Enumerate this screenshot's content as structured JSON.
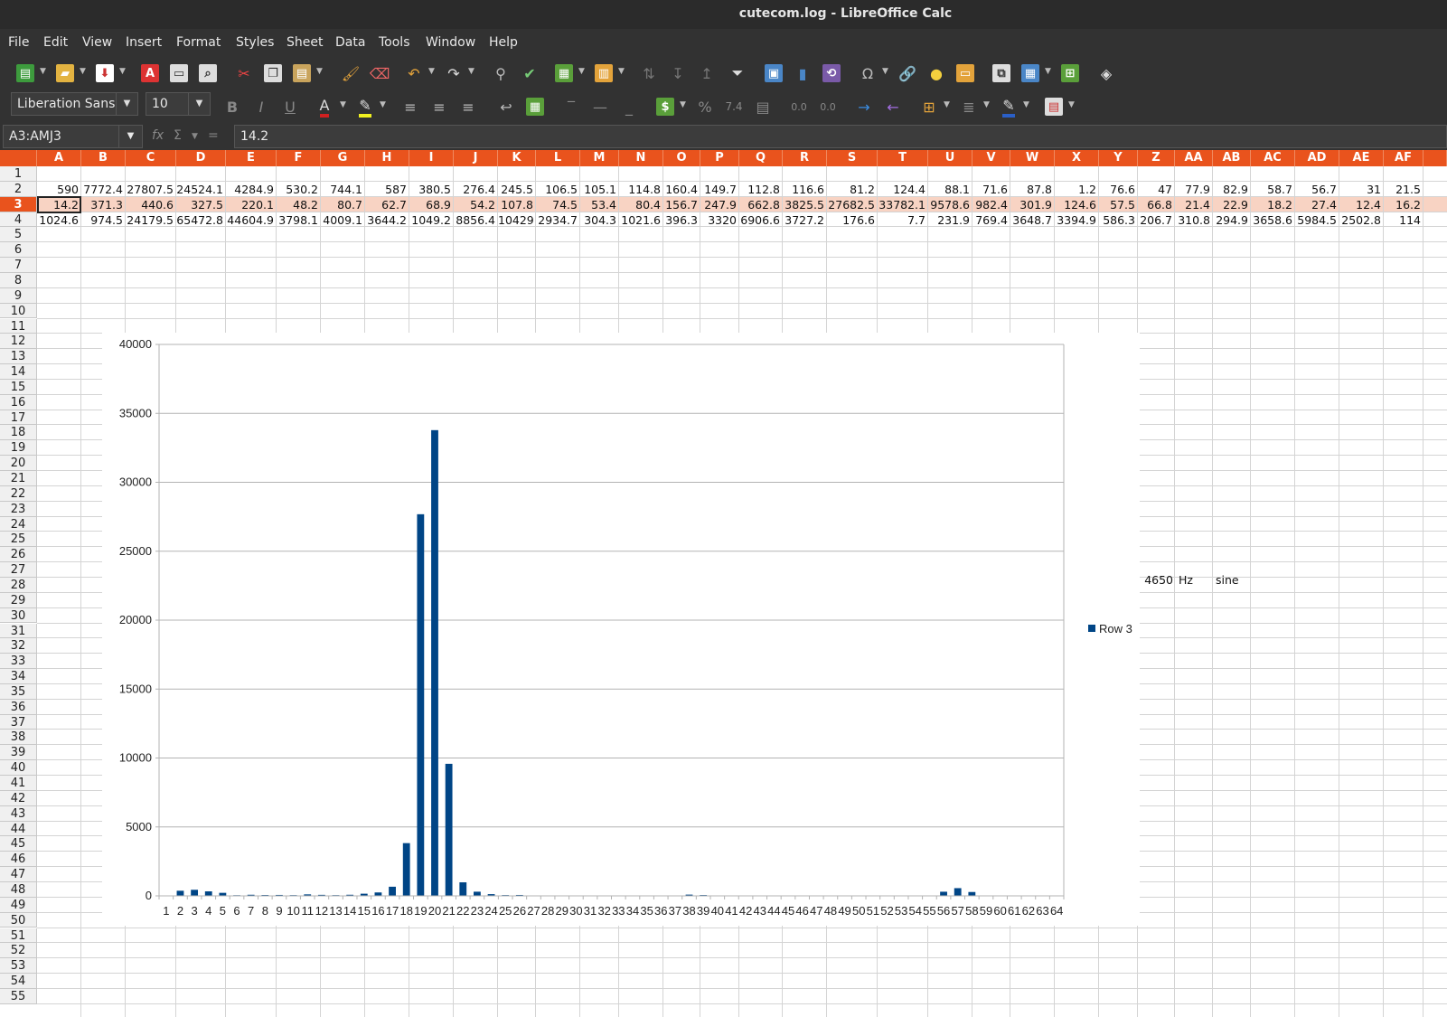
{
  "window": {
    "title": "cutecom.log - LibreOffice Calc"
  },
  "menu": [
    "File",
    "Edit",
    "View",
    "Insert",
    "Format",
    "Styles",
    "Sheet",
    "Data",
    "Tools",
    "Window",
    "Help"
  ],
  "toolbar": {
    "font_name": "Liberation Sans",
    "font_size": "10",
    "icons": [
      "new-icon",
      "open-icon",
      "save-icon",
      "export-pdf-icon",
      "print-icon",
      "print-preview-icon",
      "cut-icon",
      "copy-icon",
      "paste-icon",
      "clone-formatting-icon",
      "clear-formatting-icon",
      "undo-icon",
      "redo-icon",
      "find-replace-icon",
      "spelling-icon",
      "row-icon",
      "column-icon",
      "sort-icon",
      "sort-ascending-icon",
      "sort-descending-icon",
      "autofilter-icon",
      "insert-image-icon",
      "insert-chart-icon",
      "pivot-table-icon",
      "special-character-icon",
      "hyperlink-icon",
      "comment-icon",
      "header-footer-icon",
      "define-print-area-icon",
      "freeze-icon",
      "split-window-icon",
      "show-draw-functions-icon"
    ],
    "format_icons": [
      "bold-icon",
      "italic-icon",
      "underline-icon",
      "font-color-icon",
      "highlight-icon",
      "align-left-icon",
      "align-center-icon",
      "align-right-icon",
      "wrap-text-icon",
      "merge-center-icon",
      "align-top-icon",
      "align-middle-icon",
      "align-bottom-icon",
      "currency-icon",
      "percent-icon",
      "number-icon",
      "date-icon",
      "add-decimal-icon",
      "delete-decimal-icon",
      "increase-indent-icon",
      "decrease-indent-icon",
      "borders-icon",
      "border-style-icon",
      "border-color-icon",
      "conditional-icon"
    ]
  },
  "formula_bar": {
    "name_box": "A3:AMJ3",
    "fx_label": "fx",
    "sum_label": "Σ",
    "eq_label": "=",
    "content": "14.2"
  },
  "columns": [
    "A",
    "B",
    "C",
    "D",
    "E",
    "F",
    "G",
    "H",
    "I",
    "J",
    "K",
    "L",
    "M",
    "N",
    "O",
    "P",
    "Q",
    "R",
    "S",
    "T",
    "U",
    "V",
    "W",
    "X",
    "Y",
    "Z",
    "AA",
    "AB",
    "AC",
    "AD",
    "AE",
    "AF"
  ],
  "rows": [
    "1",
    "2",
    "3",
    "4",
    "5",
    "6",
    "7",
    "8",
    "9",
    "10",
    "11",
    "12",
    "13",
    "14",
    "15",
    "16",
    "17",
    "18",
    "19",
    "20",
    "21",
    "22",
    "23",
    "24",
    "25",
    "26",
    "27",
    "28",
    "29",
    "30",
    "31",
    "32",
    "33",
    "34",
    "35",
    "36",
    "37",
    "38",
    "39",
    "40",
    "41",
    "42",
    "43",
    "44",
    "45",
    "46",
    "47",
    "48",
    "49",
    "50",
    "51",
    "52",
    "53",
    "54",
    "55"
  ],
  "selected_row": "3",
  "cells": {
    "row2": [
      "590",
      "7772.4",
      "27807.5",
      "24524.1",
      "4284.9",
      "530.2",
      "744.1",
      "587",
      "380.5",
      "276.4",
      "245.5",
      "106.5",
      "105.1",
      "114.8",
      "160.4",
      "149.7",
      "112.8",
      "116.6",
      "81.2",
      "124.4",
      "88.1",
      "71.6",
      "87.8",
      "1.2",
      "76.6",
      "47",
      "77.9",
      "82.9",
      "58.7",
      "56.7",
      "31",
      "21.5"
    ],
    "row3": [
      "14.2",
      "371.3",
      "440.6",
      "327.5",
      "220.1",
      "48.2",
      "80.7",
      "62.7",
      "68.9",
      "54.2",
      "107.8",
      "74.5",
      "53.4",
      "80.4",
      "156.7",
      "247.9",
      "662.8",
      "3825.5",
      "27682.5",
      "33782.1",
      "9578.6",
      "982.4",
      "301.9",
      "124.6",
      "57.5",
      "66.8",
      "21.4",
      "22.9",
      "18.2",
      "27.4",
      "12.4",
      "16.2"
    ],
    "row4": [
      "1024.6",
      "974.5",
      "24179.5",
      "65472.8",
      "44604.9",
      "3798.1",
      "4009.1",
      "3644.2",
      "1049.2",
      "8856.4",
      "10429",
      "2934.7",
      "304.3",
      "1021.6",
      "396.3",
      "3320",
      "6906.6",
      "3727.2",
      "176.6",
      "7.7",
      "231.9",
      "769.4",
      "3648.7",
      "3394.9",
      "586.3",
      "206.7",
      "310.8",
      "294.9",
      "3658.6",
      "5984.5",
      "2502.8",
      "114"
    ]
  },
  "notes": {
    "z28": "4650",
    "aa28": "Hz",
    "ab28": "sine"
  },
  "chart_data": {
    "type": "bar",
    "categories": [
      "1",
      "2",
      "3",
      "4",
      "5",
      "6",
      "7",
      "8",
      "9",
      "10",
      "11",
      "12",
      "13",
      "14",
      "15",
      "16",
      "17",
      "18",
      "19",
      "20",
      "21",
      "22",
      "23",
      "24",
      "25",
      "26",
      "27",
      "28",
      "29",
      "30",
      "31",
      "32",
      "33",
      "34",
      "35",
      "36",
      "37",
      "38",
      "39",
      "40",
      "41",
      "42",
      "43",
      "44",
      "45",
      "46",
      "47",
      "48",
      "49",
      "50",
      "51",
      "52",
      "53",
      "54",
      "55",
      "56",
      "57",
      "58",
      "59",
      "60",
      "61",
      "62",
      "63",
      "64"
    ],
    "series": [
      {
        "name": "Row 3",
        "color": "#004586",
        "values": [
          14.2,
          371.3,
          440.6,
          327.5,
          220.1,
          48.2,
          80.7,
          62.7,
          68.9,
          54.2,
          107.8,
          74.5,
          53.4,
          80.4,
          156.7,
          247.9,
          662.8,
          3825.5,
          27682.5,
          33782.1,
          9578.6,
          982.4,
          301.9,
          124.6,
          57.5,
          66.8,
          21.4,
          22.9,
          18.2,
          27.4,
          12.4,
          16.2,
          10,
          10,
          10,
          10,
          30,
          90,
          60,
          10,
          5,
          5,
          5,
          5,
          5,
          5,
          5,
          5,
          5,
          5,
          5,
          5,
          5,
          5,
          10,
          300,
          560,
          280,
          10,
          10,
          10,
          10,
          10,
          10
        ]
      }
    ],
    "yticks": [
      "0",
      "5000",
      "10000",
      "15000",
      "20000",
      "25000",
      "30000",
      "35000",
      "40000"
    ],
    "ylim": [
      0,
      40000
    ],
    "grid": true,
    "legend": "right"
  }
}
